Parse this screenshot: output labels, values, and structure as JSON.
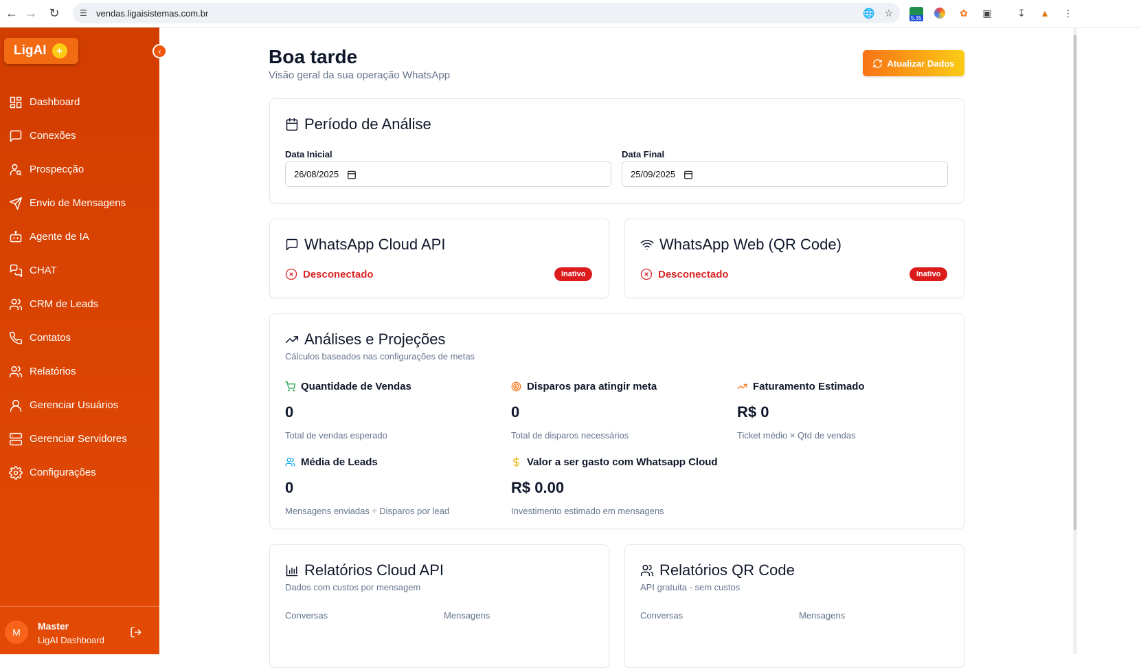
{
  "browser": {
    "url": "vendas.ligaisistemas.com.br",
    "ext_badge": "5.35"
  },
  "sidebar": {
    "logo": "LigAI",
    "items": [
      {
        "label": "Dashboard"
      },
      {
        "label": "Conexões"
      },
      {
        "label": "Prospecção"
      },
      {
        "label": "Envio de Mensagens"
      },
      {
        "label": "Agente de IA"
      },
      {
        "label": "CHAT"
      },
      {
        "label": "CRM de Leads"
      },
      {
        "label": "Contatos"
      },
      {
        "label": "Relatórios"
      },
      {
        "label": "Gerenciar Usuários"
      },
      {
        "label": "Gerenciar Servidores"
      },
      {
        "label": "Configurações"
      }
    ],
    "user": {
      "initial": "M",
      "name": "Master",
      "subtitle": "LigAI Dashboard"
    }
  },
  "header": {
    "title": "Boa tarde",
    "subtitle": "Visão geral da sua operação WhatsApp",
    "refresh_label": "Atualizar Dados"
  },
  "period": {
    "title": "Período de Análise",
    "start_label": "Data Inicial",
    "start_value": "26/08/2025",
    "end_label": "Data Final",
    "end_value": "25/09/2025"
  },
  "connections": [
    {
      "title": "WhatsApp Cloud API",
      "status": "Desconectado",
      "badge": "Inativo"
    },
    {
      "title": "WhatsApp Web (QR Code)",
      "status": "Desconectado",
      "badge": "Inativo"
    }
  ],
  "analysis": {
    "title": "Análises e Projeções",
    "subtitle": "Cálculos baseados nas configurações de metas",
    "metrics": [
      {
        "label": "Quantidade de Vendas",
        "value": "0",
        "desc": "Total de vendas esperado",
        "color": "#16a34a"
      },
      {
        "label": "Disparos para atingir meta",
        "value": "0",
        "desc": "Total de disparos necessários",
        "color": "#f97316"
      },
      {
        "label": "Faturamento Estimado",
        "value": "R$ 0",
        "desc": "Ticket médio × Qtd de vendas",
        "color": "#f97316"
      },
      {
        "label": "Média de Leads",
        "value": "0",
        "desc": "Mensagens enviadas ÷ Disparos por lead",
        "color": "#0ea5e9"
      },
      {
        "label": "Valor a ser gasto com Whatsapp Cloud",
        "value": "R$ 0.00",
        "desc": "Investimento estimado em mensagens",
        "color": "#eab308"
      }
    ]
  },
  "reports": [
    {
      "title": "Relatórios Cloud API",
      "subtitle": "Dados com custos por mensagem",
      "col1": "Conversas",
      "col2": "Mensagens"
    },
    {
      "title": "Relatórios QR Code",
      "subtitle": "API gratuita - sem custos",
      "col1": "Conversas",
      "col2": "Mensagens"
    }
  ]
}
